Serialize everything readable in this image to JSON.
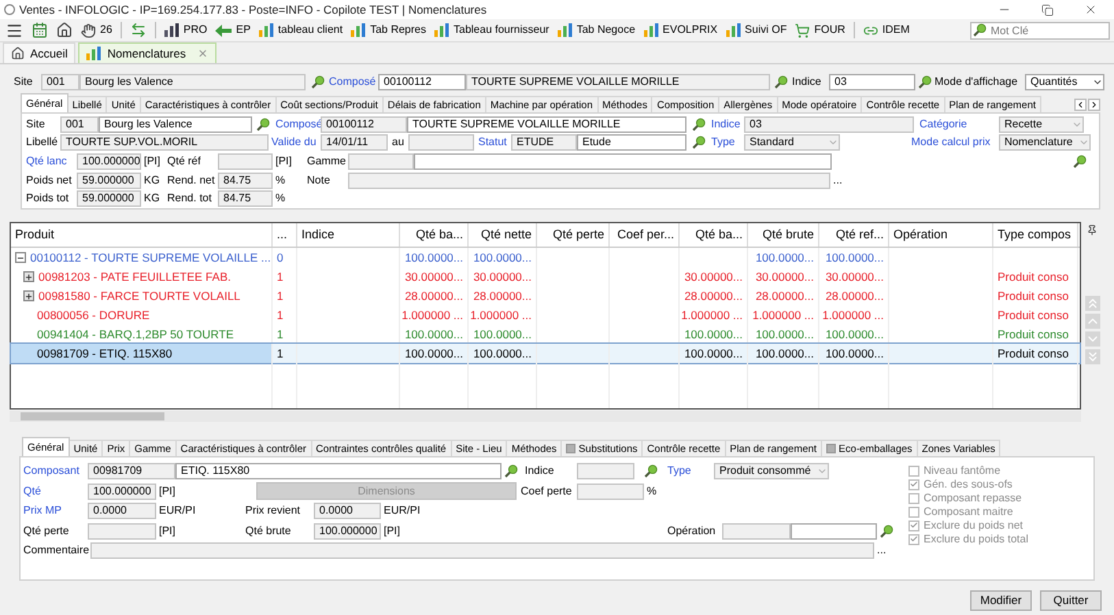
{
  "window": {
    "title": "Ventes - INFOLOGIC - IP=169.254.177.83 - Poste=INFO - Copilote TEST | Nomenclatures"
  },
  "toolbar": {
    "items": [
      {
        "kind": "menu"
      },
      {
        "kind": "calendar"
      },
      {
        "kind": "home"
      },
      {
        "kind": "hand",
        "label": "26"
      },
      {
        "kind": "separator"
      },
      {
        "kind": "swap"
      },
      {
        "kind": "separator"
      },
      {
        "kind": "chart",
        "label": "PRO"
      },
      {
        "kind": "arrow",
        "label": "EP"
      },
      {
        "kind": "bars",
        "label": "tableau client"
      },
      {
        "kind": "bars",
        "label": "Tab Repres"
      },
      {
        "kind": "bars",
        "label": "Tableau fournisseur"
      },
      {
        "kind": "bars",
        "label": "Tab Negoce"
      },
      {
        "kind": "bars",
        "label": "EVOLPRIX"
      },
      {
        "kind": "bars",
        "label": "Suivi OF"
      },
      {
        "kind": "cart",
        "label": "FOUR"
      },
      {
        "kind": "separator"
      },
      {
        "kind": "link",
        "label": "IDEM"
      }
    ],
    "search": {
      "placeholder": "Mot Clé"
    }
  },
  "doc_tabs": [
    {
      "kind": "home",
      "label": "Accueil",
      "selected": false,
      "closable": false
    },
    {
      "kind": "chart",
      "label": "Nomenclatures",
      "selected": true,
      "closable": true
    }
  ],
  "header": {
    "items": [
      {
        "kind": "label",
        "text": "Site",
        "link": false
      },
      {
        "kind": "field",
        "value": "001",
        "disabled": true
      },
      {
        "kind": "field",
        "value": "Bourg les Valence",
        "disabled": true
      },
      {
        "kind": "search"
      },
      {
        "kind": "label",
        "text": "Composé",
        "link": true
      },
      {
        "kind": "field",
        "value": "00100112",
        "disabled": false
      },
      {
        "kind": "field",
        "value": "TOURTE SUPREME VOLAILLE MORILLE",
        "disabled": true
      },
      {
        "kind": "search"
      },
      {
        "kind": "label",
        "text": "Indice",
        "link": false
      },
      {
        "kind": "field",
        "value": "03",
        "disabled": false
      },
      {
        "kind": "search"
      },
      {
        "kind": "label",
        "text": "Mode d'affichage",
        "link": false
      },
      {
        "kind": "select",
        "value": "Quantités",
        "disabled": false
      }
    ]
  },
  "main_tabs": [
    {
      "label": "Général",
      "selected": true
    },
    {
      "label": "Libellé",
      "selected": false
    },
    {
      "label": "Unité",
      "selected": false
    },
    {
      "label": "Caractéristiques à contrôler",
      "selected": false
    },
    {
      "label": "Coût sections/Produit",
      "selected": false
    },
    {
      "label": "Délais de fabrication",
      "selected": false
    },
    {
      "label": "Machine par opération",
      "selected": false
    },
    {
      "label": "Méthodes",
      "selected": false
    },
    {
      "label": "Composition",
      "selected": false
    },
    {
      "label": "Allergènes",
      "selected": false
    },
    {
      "label": "Mode opératoire",
      "selected": false
    },
    {
      "label": "Contrôle recette",
      "selected": false
    },
    {
      "label": "Plan de rangement",
      "selected": false
    }
  ],
  "general_form": {
    "lines": [
      {
        "items": [
          {
            "kind": "label",
            "text": "Site",
            "link": false
          },
          {
            "kind": "field",
            "value": "001",
            "disabled": true
          },
          {
            "kind": "field",
            "value": "Bourg les Valence",
            "disabled": false
          },
          {
            "kind": "search"
          },
          {
            "kind": "label",
            "text": "Composé",
            "link": true
          },
          {
            "kind": "field",
            "value": "00100112",
            "disabled": true
          },
          {
            "kind": "field",
            "value": "TOURTE SUPREME VOLAILLE MORILLE",
            "disabled": false
          },
          {
            "kind": "search"
          },
          {
            "kind": "label",
            "text": "Indice",
            "link": true
          },
          {
            "kind": "field",
            "value": "03",
            "disabled": true
          },
          {
            "kind": "label",
            "text": "Catégorie",
            "link": true
          },
          {
            "kind": "select",
            "value": "Recette",
            "disabled": true
          }
        ]
      },
      {
        "items": [
          {
            "kind": "label",
            "text": "Libellé",
            "link": false
          },
          {
            "kind": "field",
            "value": "TOURTE SUP.VOL.MORIL",
            "disabled": true
          },
          {
            "kind": "label",
            "text": "Valide du",
            "link": true
          },
          {
            "kind": "field",
            "value": "14/01/11",
            "disabled": true
          },
          {
            "kind": "label",
            "text": "au",
            "link": false
          },
          {
            "kind": "field",
            "disabled": true
          },
          {
            "kind": "label",
            "text": "Statut",
            "link": true
          },
          {
            "kind": "field",
            "value": "ETUDE",
            "disabled": true
          },
          {
            "kind": "field",
            "value": "Etude",
            "disabled": false
          },
          {
            "kind": "search"
          },
          {
            "kind": "label",
            "text": "Type",
            "link": true
          },
          {
            "kind": "select",
            "value": "Standard",
            "disabled": true
          },
          {
            "kind": "label",
            "text": "Mode calcul prix",
            "link": true
          },
          {
            "kind": "select",
            "value": "Nomenclature",
            "disabled": true
          }
        ]
      },
      {
        "items": [
          {
            "kind": "label",
            "text": "Qté lanc",
            "link": true
          },
          {
            "kind": "field",
            "value": "100.000000",
            "disabled": true
          },
          {
            "kind": "unit",
            "text": "[PI]"
          },
          {
            "kind": "label",
            "text": "Qté réf",
            "link": false
          },
          {
            "kind": "field",
            "disabled": true
          },
          {
            "kind": "unit",
            "text": "[PI]"
          },
          {
            "kind": "label",
            "text": "Gamme",
            "link": false
          },
          {
            "kind": "field",
            "disabled": true
          },
          {
            "kind": "field",
            "disabled": false
          },
          {
            "kind": "search"
          }
        ]
      },
      {
        "items": [
          {
            "kind": "label",
            "text": "Poids net",
            "link": false
          },
          {
            "kind": "field",
            "value": "59.000000",
            "disabled": true
          },
          {
            "kind": "unit",
            "text": "KG"
          },
          {
            "kind": "label",
            "text": "Rend. net",
            "link": false
          },
          {
            "kind": "field",
            "value": "84.75",
            "disabled": true
          },
          {
            "kind": "unit",
            "text": "%"
          },
          {
            "kind": "label",
            "text": "Note",
            "link": false
          },
          {
            "kind": "field",
            "disabled": true
          },
          {
            "kind": "more",
            "text": "..."
          }
        ]
      },
      {
        "items": [
          {
            "kind": "label",
            "text": "Poids tot",
            "link": false
          },
          {
            "kind": "field",
            "value": "59.000000",
            "disabled": true
          },
          {
            "kind": "unit",
            "text": "KG"
          },
          {
            "kind": "label",
            "text": "Rend. tot",
            "link": false
          },
          {
            "kind": "field",
            "value": "84.75",
            "disabled": true
          },
          {
            "kind": "unit",
            "text": "%"
          }
        ]
      }
    ]
  },
  "table": {
    "columns": [
      "Produit",
      "...",
      "Indice",
      "Qté ba...",
      "Qté nette",
      "Qté perte",
      "Coef per...",
      "Qté ba...",
      "Qté brute",
      "Qté ref...",
      "Opération",
      "Type compos"
    ],
    "rows": [
      {
        "cells": [
          "00100112 - TOURTE SUPREME VOLAILLE ...",
          "0",
          null,
          "100.0000...",
          "100.0000...",
          null,
          null,
          null,
          "100.0000...",
          "100.0000...",
          null,
          null
        ],
        "color": "#3a5fcd",
        "has_children": true,
        "expanded": true,
        "selected": false,
        "children": [
          {
            "cells": [
              "00981203 - PATE FEUILLETEE FAB.",
              "1",
              null,
              "30.00000...",
              "30.00000...",
              null,
              null,
              "30.00000...",
              "30.00000...",
              "30.00000...",
              null,
              "Produit conso"
            ],
            "color": "#e8202a",
            "has_children": true,
            "expanded": false,
            "selected": false
          },
          {
            "cells": [
              "00981580 - FARCE TOURTE VOLAILL",
              "1",
              null,
              "28.00000...",
              "28.00000...",
              null,
              null,
              "28.00000...",
              "28.00000...",
              "28.00000...",
              null,
              "Produit conso"
            ],
            "color": "#e8202a",
            "has_children": true,
            "expanded": false,
            "selected": false
          },
          {
            "cells": [
              "00800056 - DORURE",
              "1",
              null,
              "1.000000 ...",
              "1.000000 ...",
              null,
              null,
              "1.000000 ...",
              "1.000000 ...",
              "1.000000 ...",
              null,
              "Produit conso"
            ],
            "color": "#e8202a",
            "has_children": false,
            "selected": false
          },
          {
            "cells": [
              "00941404 - BARQ.1,2BP 50 TOURTE",
              "1",
              null,
              "100.0000...",
              "100.0000...",
              null,
              null,
              "100.0000...",
              "100.0000...",
              "100.0000...",
              null,
              "Produit conso"
            ],
            "color": "#2e8b2e",
            "has_children": false,
            "selected": false
          },
          {
            "cells": [
              "00981709 - ETIQ. 115X80",
              "1",
              null,
              "100.0000...",
              "100.0000...",
              null,
              null,
              "100.0000...",
              "100.0000...",
              "100.0000...",
              null,
              "Produit conso"
            ],
            "color": "#000000",
            "has_children": false,
            "selected": true
          }
        ]
      }
    ]
  },
  "detail_tabs": [
    {
      "label": "Général",
      "selected": true,
      "kind": "plain"
    },
    {
      "label": "Unité",
      "selected": false,
      "kind": "plain"
    },
    {
      "label": "Prix",
      "selected": false,
      "kind": "plain"
    },
    {
      "label": "Gamme",
      "selected": false,
      "kind": "plain"
    },
    {
      "label": "Caractéristiques à contrôler",
      "selected": false,
      "kind": "plain"
    },
    {
      "label": "Contraintes contrôles qualité",
      "selected": false,
      "kind": "plain"
    },
    {
      "label": "Site - Lieu",
      "selected": false,
      "kind": "plain"
    },
    {
      "label": "Méthodes",
      "selected": false,
      "kind": "plain"
    },
    {
      "label": "Substitutions",
      "selected": false,
      "kind": "icon"
    },
    {
      "label": "Contrôle recette",
      "selected": false,
      "kind": "plain"
    },
    {
      "label": "Plan de rangement",
      "selected": false,
      "kind": "plain"
    },
    {
      "label": "Eco-emballages",
      "selected": false,
      "kind": "icon"
    },
    {
      "label": "Zones Variables",
      "selected": false,
      "kind": "plain"
    }
  ],
  "detail_form": {
    "lines": [
      {
        "items": [
          {
            "kind": "label",
            "text": "Composant",
            "link": true
          },
          {
            "kind": "field",
            "value": "00981709",
            "disabled": true
          },
          {
            "kind": "field",
            "value": "ETIQ. 115X80",
            "disabled": false
          },
          {
            "kind": "search"
          },
          {
            "kind": "label",
            "text": "Indice",
            "link": false
          },
          {
            "kind": "field",
            "disabled": true
          },
          {
            "kind": "search"
          },
          {
            "kind": "label",
            "text": "Type",
            "link": true
          },
          {
            "kind": "select",
            "value": "Produit consommé",
            "disabled": true
          }
        ]
      },
      {
        "items": [
          {
            "kind": "label",
            "text": "Qté",
            "link": true
          },
          {
            "kind": "field",
            "value": "100.000000",
            "disabled": true
          },
          {
            "kind": "unit",
            "text": "[PI]"
          },
          {
            "kind": "button",
            "text": "Dimensions",
            "disabled": true
          },
          {
            "kind": "label",
            "text": "Coef perte",
            "link": false
          },
          {
            "kind": "field",
            "disabled": true
          },
          {
            "kind": "unit",
            "text": "%"
          }
        ]
      },
      {
        "items": [
          {
            "kind": "label",
            "text": "Prix MP",
            "link": true
          },
          {
            "kind": "field",
            "value": "0.0000",
            "disabled": true
          },
          {
            "kind": "unit",
            "text": "EUR/PI"
          },
          {
            "kind": "label",
            "text": "Prix revient",
            "link": false
          },
          {
            "kind": "field",
            "value": "0.0000",
            "disabled": true
          },
          {
            "kind": "unit",
            "text": "EUR/PI"
          }
        ]
      },
      {
        "items": [
          {
            "kind": "label",
            "text": "Qté perte",
            "link": false
          },
          {
            "kind": "field",
            "disabled": true
          },
          {
            "kind": "unit",
            "text": "[PI]"
          },
          {
            "kind": "label",
            "text": "Qté brute",
            "link": false
          },
          {
            "kind": "field",
            "value": "100.000000",
            "disabled": true
          },
          {
            "kind": "unit",
            "text": "[PI]"
          },
          {
            "kind": "label",
            "text": "Opération",
            "link": false
          },
          {
            "kind": "field",
            "disabled": true
          },
          {
            "kind": "field",
            "disabled": false
          },
          {
            "kind": "search"
          }
        ]
      },
      {
        "items": [
          {
            "kind": "label",
            "text": "Commentaire",
            "link": false
          },
          {
            "kind": "field",
            "disabled": true
          },
          {
            "kind": "more",
            "text": "..."
          }
        ]
      }
    ],
    "options": [
      {
        "label": "Niveau fantôme",
        "checked": false,
        "disabled": true
      },
      {
        "label": "Gén. des sous-ofs",
        "checked": true,
        "disabled": true
      },
      {
        "label": "Composant repasse",
        "checked": false,
        "disabled": true
      },
      {
        "label": "Composant maitre",
        "checked": false,
        "disabled": true
      },
      {
        "label": "Exclure du poids net",
        "checked": true,
        "disabled": true
      },
      {
        "label": "Exclure du poids total",
        "checked": true,
        "disabled": true
      }
    ]
  },
  "buttons": [
    "Modifier",
    "Quitter"
  ]
}
